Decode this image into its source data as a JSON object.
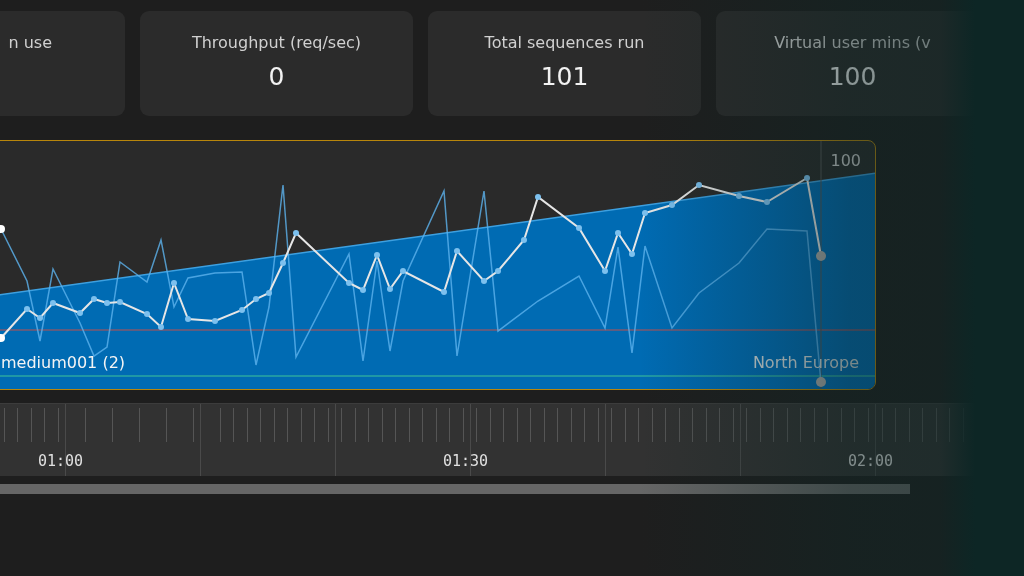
{
  "stats": [
    {
      "label": "n use"
    },
    {
      "label": "Throughput (req/sec)",
      "value": "0"
    },
    {
      "label": "Total sequences run",
      "value": "101"
    },
    {
      "label": "Virtual user mins (v",
      "value": "100"
    }
  ],
  "chart": {
    "series_label": "medium001 (2)",
    "region_label": "North Europe",
    "axis_label": "100"
  },
  "timeline": {
    "labels": [
      "01:00",
      "01:30",
      "02:00"
    ]
  }
}
